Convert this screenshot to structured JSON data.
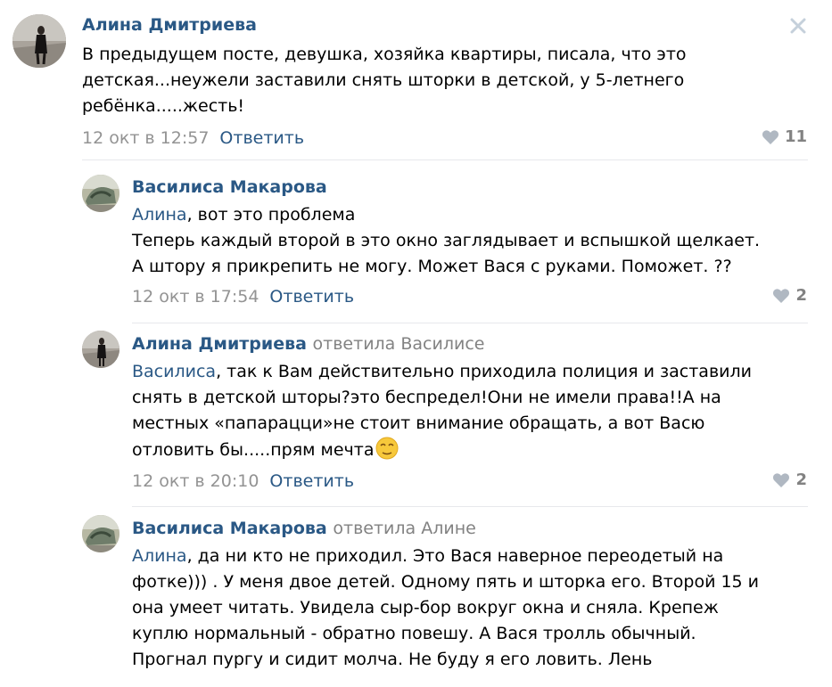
{
  "close_icon": "close-icon",
  "accent_color": "#2a5885",
  "comments": [
    {
      "author": "Алина Дмитриева",
      "replied_to": "",
      "mention": "",
      "lines": [
        "В предыдущем посте, девушка, хозяйка квартиры, писала, что это",
        "детская...неужели заставили снять шторки в детской, у 5-летнего",
        "ребёнка.....жесть!"
      ],
      "time": "12 окт в 12:57",
      "reply_label": "Ответить",
      "likes": "11"
    },
    {
      "author": "Василиса Макарова",
      "replied_to": "",
      "mention": "Алина",
      "lines": [
        ", вот это проблема",
        "Теперь каждый второй в это окно заглядывает и вспышкой щелкает.",
        "А штору я прикрепить не могу. Может Вася с руками. Поможет. ??"
      ],
      "time": "12 окт в 17:54",
      "reply_label": "Ответить",
      "likes": "2"
    },
    {
      "author": "Алина Дмитриева",
      "replied_to": "ответила Василисе",
      "mention": "Василиса",
      "lines": [
        ", так к Вам действительно приходила полиция и заставили",
        "снять в детской шторы?это беспредел!Они не имели права!!А на",
        "местных «папарацци»не стоит внимание обращать, а вот Васю",
        "отловить бы.....прям мечта"
      ],
      "emoji": "relieved-face-emoji",
      "time": "12 окт в 20:10",
      "reply_label": "Ответить",
      "likes": "2"
    },
    {
      "author": "Василиса Макарова",
      "replied_to": "ответила Алине",
      "mention": "Алина",
      "lines": [
        ", да ни кто не приходил. Это Вася наверное переодетый на",
        "фотке))) . У меня двое детей. Одному пять и шторка его. Второй 15 и",
        "она умеет читать. Увидела сыр-бор вокруг окна и сняла. Крепеж",
        "куплю нормальный - обратно повешу. А Вася тролль обычный.",
        "Прогнал пургу и сидит молча. Не буду я его ловить. Лень"
      ]
    }
  ]
}
